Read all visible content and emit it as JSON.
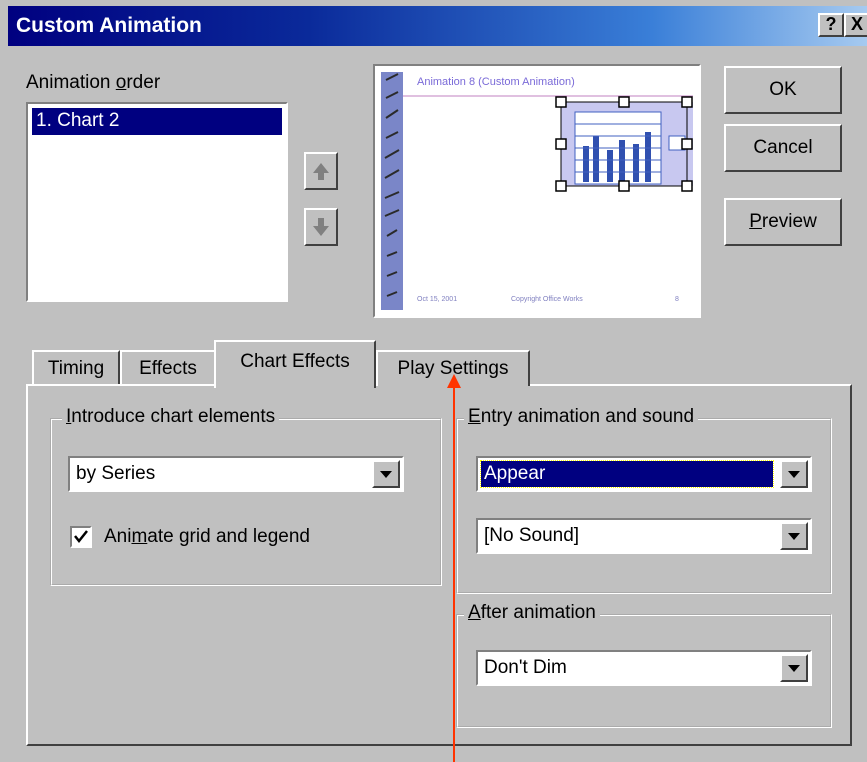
{
  "window": {
    "title": "Custom Animation",
    "help_label": "?",
    "close_label": "X"
  },
  "animation_order": {
    "label_pre": "Animation ",
    "label_u": "o",
    "label_post": "rder",
    "items": [
      "1. Chart 2"
    ]
  },
  "preview": {
    "slide_title": "Animation 8 (Custom Animation)",
    "footer_left": "Oct 15, 2001",
    "footer_mid": "Copyright Office Works",
    "footer_right": "8"
  },
  "buttons": {
    "ok": "OK",
    "cancel": "Cancel",
    "preview_u": "P",
    "preview_rest": "review"
  },
  "tabs": [
    "Timing",
    "Effects",
    "Chart Effects",
    "Play Settings"
  ],
  "introduce": {
    "legend_u": "I",
    "legend_rest": "ntroduce chart elements",
    "value": "by Series",
    "checkbox_pre": "Ani",
    "checkbox_u": "m",
    "checkbox_post": "ate grid and legend",
    "checked": true
  },
  "entry": {
    "legend_u": "E",
    "legend_rest": "ntry animation and sound",
    "effect_value": "Appear",
    "sound_value": "[No Sound]"
  },
  "after": {
    "legend_u": "A",
    "legend_rest": "fter animation",
    "value": "Don't Dim"
  },
  "colors": {
    "title_start": "#000080",
    "selection": "#000080",
    "annotation_arrow": "#ff3300"
  }
}
